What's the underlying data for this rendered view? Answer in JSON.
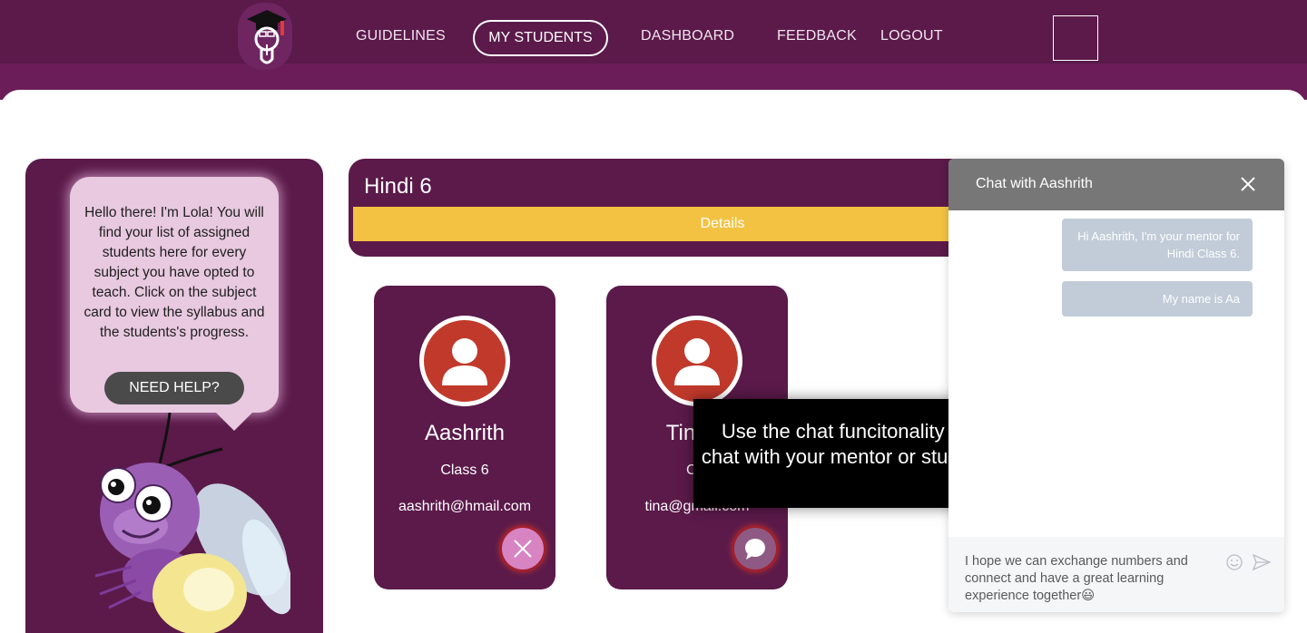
{
  "nav": {
    "items": [
      "GUIDELINES",
      "MY STUDENTS",
      "DASHBOARD",
      "FEEDBACK",
      "LOGOUT"
    ],
    "active": "MY STUDENTS"
  },
  "lola": {
    "message": "Hello there! I'm Lola! You will find your list of assigned students here for every subject you have opted to teach. Click on the subject card to view the syllabus and the students's progress.",
    "help_button": "NEED HELP?"
  },
  "subject": {
    "title": "Hindi 6",
    "details_label": "Details"
  },
  "students": [
    {
      "name": "Aashrith",
      "class": "Class 6",
      "email": "aashrith@hmail.com",
      "action_icon": "close-icon"
    },
    {
      "name": "Tina S",
      "class": "Cla",
      "email": "tina@gmail.com",
      "action_icon": "chat-icon"
    }
  ],
  "tooltip": {
    "text": "Use the chat funcitonality to chat with your mentor or student"
  },
  "chat": {
    "title": "Chat with Aashrith",
    "messages": [
      "Hi Aashrith, I'm your mentor for Hindi Class 6.",
      "My name is Aa"
    ],
    "input_value": "I hope we can exchange numbers and connect and have a great learning experience together😃"
  },
  "colors": {
    "primary": "#5b1a4a",
    "accent": "#f3c242",
    "avatar": "#c0392b",
    "chat_header": "#777777",
    "chat_bubble": "#c1ccd8"
  }
}
